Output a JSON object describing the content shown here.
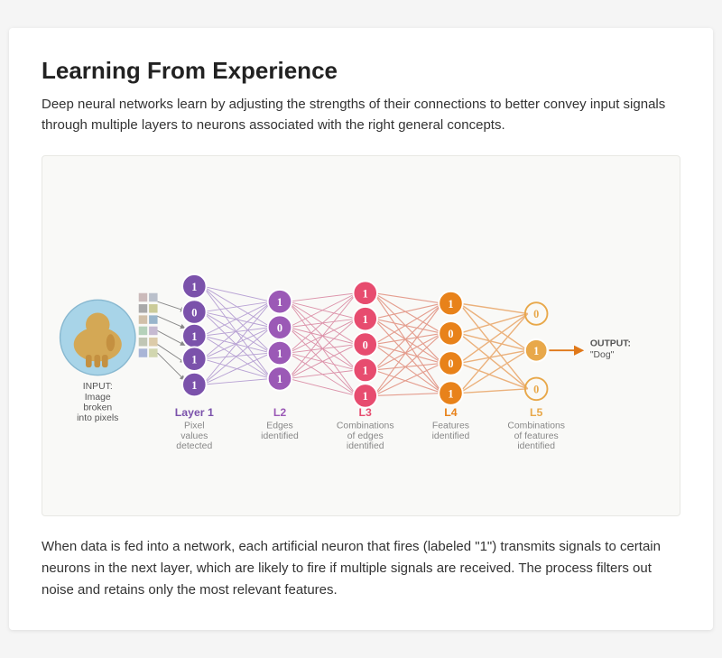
{
  "title": "Learning From Experience",
  "intro": "Deep neural networks learn by adjusting the strengths of their connections to better convey input signals through multiple layers to neurons associated with the right general concepts.",
  "bottom": "When data is fed into a network, each artificial neuron that fires (labeled \"1\") transmits signals to certain neurons in the next layer, which are likely to fire if multiple signals are received. The process filters out noise and retains only the most relevant features.",
  "layers": [
    {
      "id": "L1",
      "label": "Layer 1",
      "sub": "Pixel\nvalues\ndetected",
      "color": "#7b52ab"
    },
    {
      "id": "L2",
      "label": "L2",
      "sub": "Edges\nidentified",
      "color": "#9b59b6"
    },
    {
      "id": "L3",
      "label": "L3",
      "sub": "Combinations\nof edges\nidentified",
      "color": "#e74c6f"
    },
    {
      "id": "L4",
      "label": "L4",
      "sub": "Features\nidentified",
      "color": "#e8821a"
    },
    {
      "id": "L5",
      "label": "L5",
      "sub": "Combinations\nof features\nidentified",
      "color": "#e8a84a"
    }
  ],
  "input_label": "INPUT:\nImage\nbroken\ninto pixels",
  "output_label": "OUTPUT:\n\"Dog\""
}
